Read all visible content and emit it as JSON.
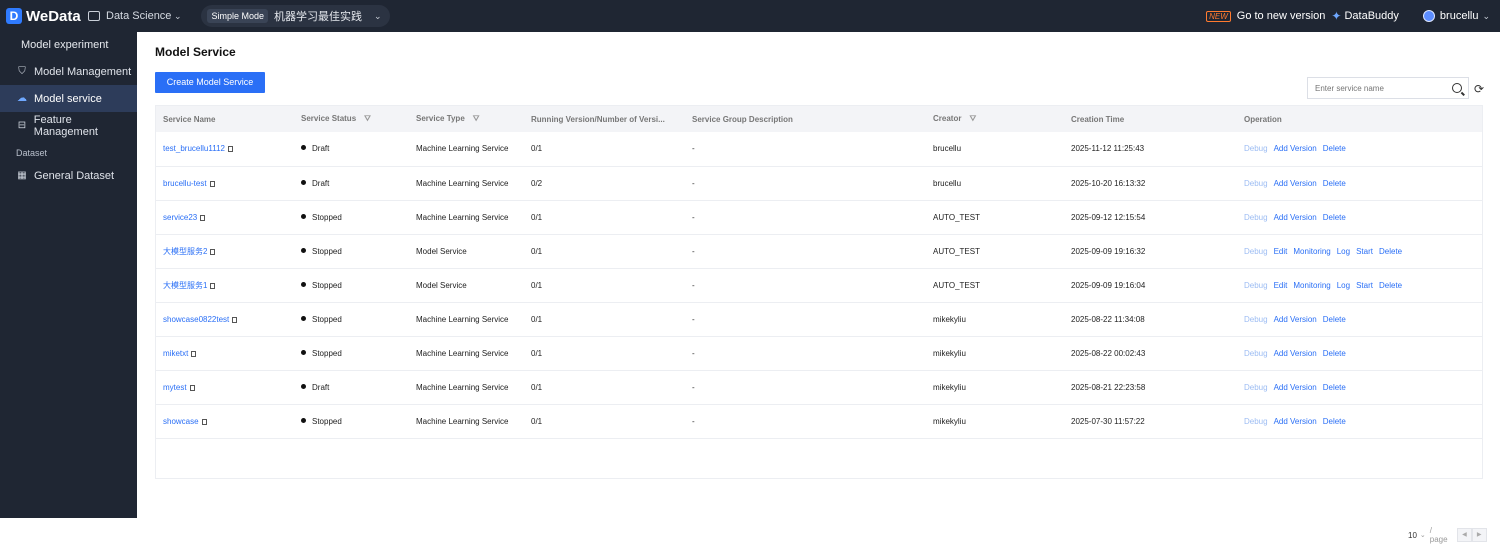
{
  "topbar": {
    "brand": "WeData",
    "workspace": "Data Science",
    "mode_badge": "Simple Mode",
    "project": "机器学习最佳实践",
    "new_badge": "NEW",
    "new_version": "Go to new version",
    "databuddy": "DataBuddy",
    "user": "brucellu"
  },
  "sidebar": {
    "heading": "Model experiment",
    "items": [
      {
        "label": "Model Management",
        "icon": "model-icon"
      },
      {
        "label": "Model service",
        "icon": "service-icon",
        "active": true
      },
      {
        "label": "Feature Management",
        "icon": "feature-icon"
      }
    ],
    "group_label": "Dataset",
    "dataset_item": {
      "label": "General Dataset",
      "icon": "grid-icon"
    }
  },
  "main": {
    "title": "Model Service",
    "create_button": "Create Model Service",
    "search_placeholder": "Enter service name",
    "columns": [
      "Service Name",
      "Service Status",
      "Service Type",
      "Running Version/Number of Versi...",
      "Service Group Description",
      "Creator",
      "Creation Time",
      "Operation"
    ],
    "rows": [
      {
        "name": "test_brucellu1112",
        "status": "Draft",
        "type": "Machine Learning Service",
        "versions": "0/1",
        "desc": "-",
        "creator": "brucellu",
        "time": "2025-11-12 11:25:43",
        "ops": [
          "Debug",
          "Add Version",
          "Delete"
        ]
      },
      {
        "name": "brucellu-test",
        "status": "Draft",
        "type": "Machine Learning Service",
        "versions": "0/2",
        "desc": "-",
        "creator": "brucellu",
        "time": "2025-10-20 16:13:32",
        "ops": [
          "Debug",
          "Add Version",
          "Delete"
        ]
      },
      {
        "name": "service23",
        "status": "Stopped",
        "type": "Machine Learning Service",
        "versions": "0/1",
        "desc": "-",
        "creator": "AUTO_TEST",
        "time": "2025-09-12 12:15:54",
        "ops": [
          "Debug",
          "Add Version",
          "Delete"
        ]
      },
      {
        "name": "大模型服务2",
        "status": "Stopped",
        "type": "Model Service",
        "versions": "0/1",
        "desc": "-",
        "creator": "AUTO_TEST",
        "time": "2025-09-09 19:16:32",
        "ops": [
          "Debug",
          "Edit",
          "Monitoring",
          "Log",
          "Start",
          "Delete"
        ]
      },
      {
        "name": "大模型服务1",
        "status": "Stopped",
        "type": "Model Service",
        "versions": "0/1",
        "desc": "-",
        "creator": "AUTO_TEST",
        "time": "2025-09-09 19:16:04",
        "ops": [
          "Debug",
          "Edit",
          "Monitoring",
          "Log",
          "Start",
          "Delete"
        ]
      },
      {
        "name": "showcase0822test",
        "status": "Stopped",
        "type": "Machine Learning Service",
        "versions": "0/1",
        "desc": "-",
        "creator": "mikekyliu",
        "time": "2025-08-22 11:34:08",
        "ops": [
          "Debug",
          "Add Version",
          "Delete"
        ]
      },
      {
        "name": "miketxt",
        "status": "Stopped",
        "type": "Machine Learning Service",
        "versions": "0/1",
        "desc": "-",
        "creator": "mikekyliu",
        "time": "2025-08-22 00:02:43",
        "ops": [
          "Debug",
          "Add Version",
          "Delete"
        ]
      },
      {
        "name": "mytest",
        "status": "Draft",
        "type": "Machine Learning Service",
        "versions": "0/1",
        "desc": "-",
        "creator": "mikekyliu",
        "time": "2025-08-21 22:23:58",
        "ops": [
          "Debug",
          "Add Version",
          "Delete"
        ]
      },
      {
        "name": "showcase",
        "status": "Stopped",
        "type": "Machine Learning Service",
        "versions": "0/1",
        "desc": "-",
        "creator": "mikekyliu",
        "time": "2025-07-30 11:57:22",
        "ops": [
          "Debug",
          "Add Version",
          "Delete"
        ]
      }
    ],
    "pagination": {
      "page_size": "10",
      "per_page_label": "/ page"
    }
  }
}
